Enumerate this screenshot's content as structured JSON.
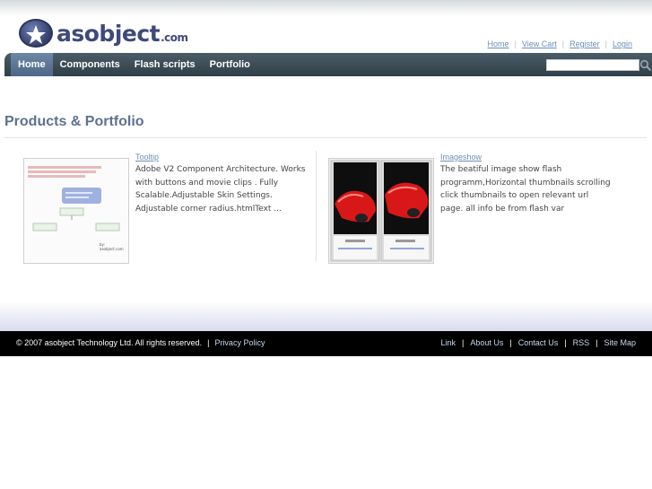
{
  "brand": {
    "name": "asobject",
    "suffix": ".com"
  },
  "toplinks": [
    {
      "label": "Home"
    },
    {
      "label": "View Cart"
    },
    {
      "label": "Register"
    },
    {
      "label": "Login"
    }
  ],
  "nav": {
    "items": [
      {
        "label": "Home",
        "active": true
      },
      {
        "label": "Components"
      },
      {
        "label": "Flash scripts"
      },
      {
        "label": "Portfolio"
      }
    ],
    "search_placeholder": ""
  },
  "page": {
    "title": "Products & Portfolio"
  },
  "products": [
    {
      "title": "Tooltip",
      "description": "Adobe V2 Component Architecture. Works with buttons and movie clips . Fully Scalable.Adjustable Skin Settings. Adjustable corner radius.htmlText ...",
      "thumb_caption": "by: asobject.com"
    },
    {
      "title": "Imageshow",
      "description": "The beatiful image show flash programm,Horizontal thumbnails scrolling click thumbnails to open relevant url page. all info be from flash var"
    }
  ],
  "footer": {
    "copyright": "© 2007 asobject Technology Ltd. All rights reserved.",
    "privacy": "Privacy Policy",
    "links": [
      {
        "label": "Link"
      },
      {
        "label": "About Us"
      },
      {
        "label": "Contact Us"
      },
      {
        "label": "RSS"
      },
      {
        "label": "Site Map"
      }
    ]
  },
  "colors": {
    "nav_bg": "#3a4b54",
    "nav_active": "#5f7896",
    "heading": "#5d7190",
    "link": "#6b8fb8",
    "footer_bg": "#000000"
  }
}
